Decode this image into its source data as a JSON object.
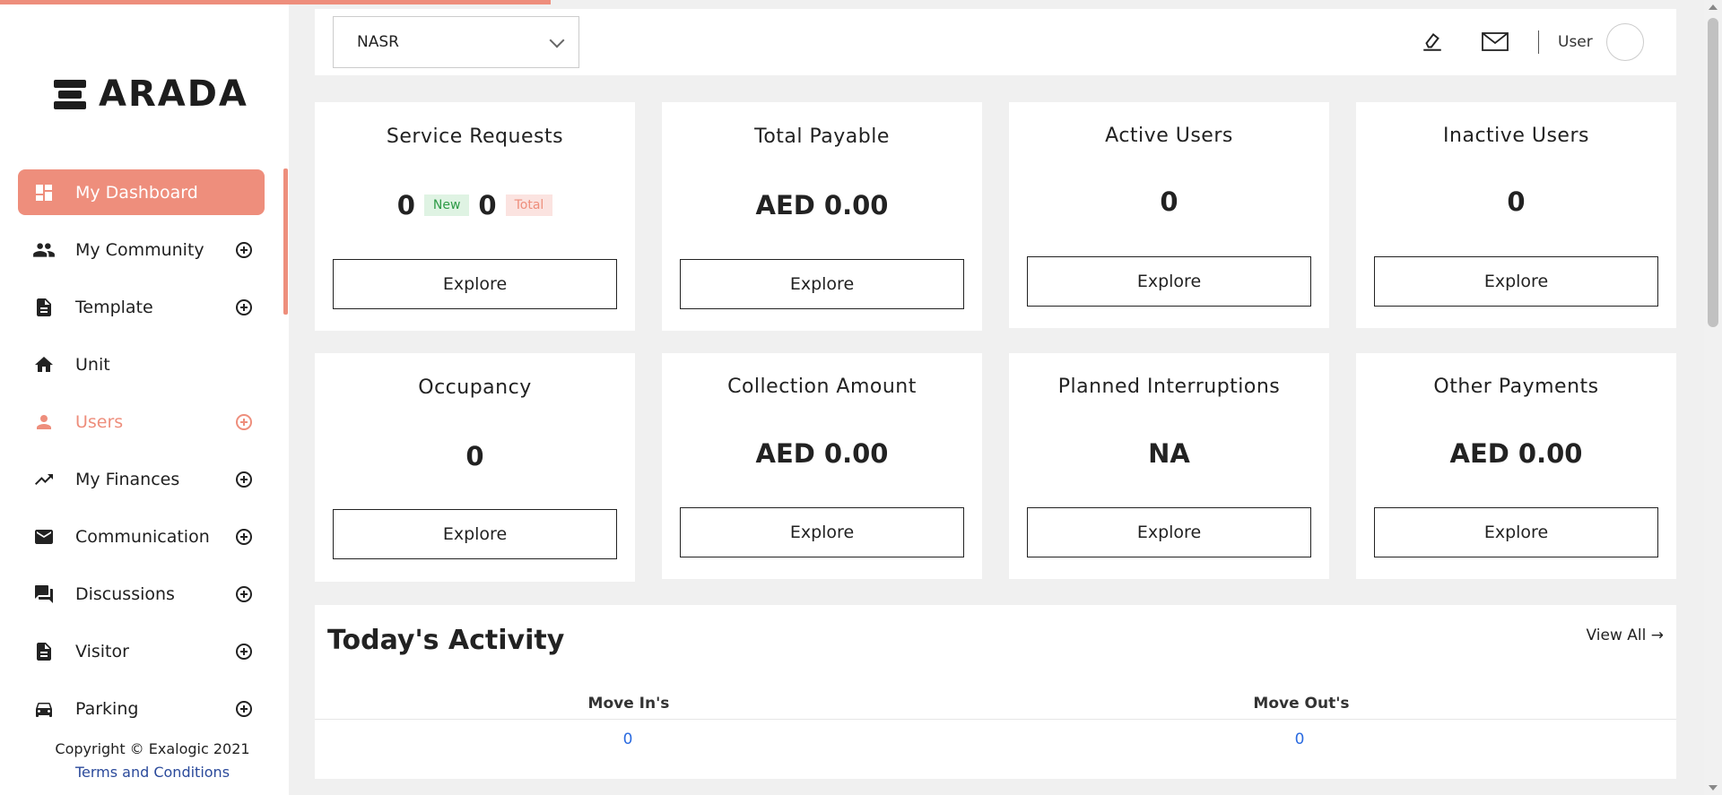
{
  "brand": {
    "name": "ARADA"
  },
  "colors": {
    "accent": "#ee8e7c",
    "link": "#2b4a9b",
    "value_link": "#2b6be0"
  },
  "progress": {
    "percent": 32
  },
  "sidebar": {
    "items": [
      {
        "label": "My Dashboard",
        "icon": "dashboard-icon",
        "state": "active",
        "expandable": false
      },
      {
        "label": "My Community",
        "icon": "people-icon",
        "state": "normal",
        "expandable": true
      },
      {
        "label": "Template",
        "icon": "document-icon",
        "state": "normal",
        "expandable": true
      },
      {
        "label": "Unit",
        "icon": "home-icon",
        "state": "normal",
        "expandable": false
      },
      {
        "label": "Users",
        "icon": "person-icon",
        "state": "highlight",
        "expandable": true
      },
      {
        "label": "My Finances",
        "icon": "trending-up-icon",
        "state": "normal",
        "expandable": true
      },
      {
        "label": "Communication",
        "icon": "mail-icon",
        "state": "normal",
        "expandable": true
      },
      {
        "label": "Discussions",
        "icon": "forum-icon",
        "state": "normal",
        "expandable": true
      },
      {
        "label": "Visitor",
        "icon": "document-icon",
        "state": "normal",
        "expandable": true
      },
      {
        "label": "Parking",
        "icon": "car-icon",
        "state": "normal",
        "expandable": true
      }
    ],
    "copyright": "Copyright © Exalogic 2021",
    "terms": "Terms and Conditions"
  },
  "header": {
    "community_select": "NASR",
    "user_label": "User"
  },
  "cards": {
    "service_requests": {
      "title": "Service Requests",
      "new_count": "0",
      "new_label": "New",
      "total_count": "0",
      "total_label": "Total",
      "button": "Explore"
    },
    "total_payable": {
      "title": "Total Payable",
      "value": "AED 0.00",
      "button": "Explore"
    },
    "active_users": {
      "title": "Active Users",
      "value": "0",
      "button": "Explore"
    },
    "inactive_users": {
      "title": "Inactive Users",
      "value": "0",
      "button": "Explore"
    },
    "occupancy": {
      "title": "Occupancy",
      "value": "0",
      "button": "Explore"
    },
    "collection_amount": {
      "title": "Collection Amount",
      "value": "AED 0.00",
      "button": "Explore"
    },
    "planned_interruptions": {
      "title": "Planned Interruptions",
      "value": "NA",
      "button": "Explore"
    },
    "other_payments": {
      "title": "Other Payments",
      "value": "AED 0.00",
      "button": "Explore"
    }
  },
  "activity": {
    "title": "Today's Activity",
    "view_all": "View All →",
    "columns": [
      {
        "label": "Move In's",
        "value": "0"
      },
      {
        "label": "Move Out's",
        "value": "0"
      }
    ]
  }
}
